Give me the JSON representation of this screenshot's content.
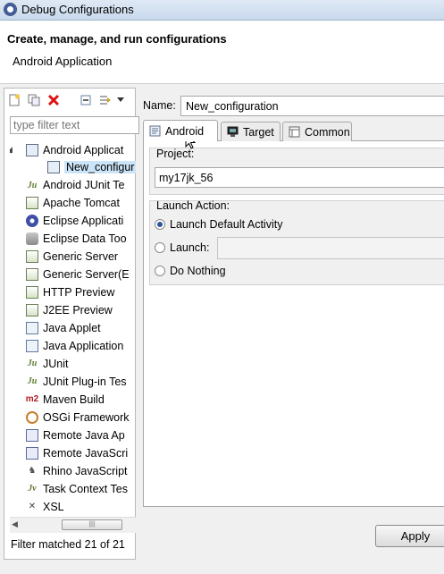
{
  "window": {
    "title": "Debug Configurations",
    "icon": "debug-gear-icon"
  },
  "header": {
    "title": "Create, manage, and run configurations",
    "subtitle": "Android Application"
  },
  "left_toolbar": {
    "buttons": [
      "new-config-icon",
      "duplicate-icon",
      "delete-icon",
      "collapse-all-icon",
      "filter-icon",
      "dropdown-icon"
    ]
  },
  "filter": {
    "placeholder": "type filter text",
    "value": ""
  },
  "tree": {
    "items": [
      {
        "label": "Android Applicat",
        "icon": "android-app-icon",
        "level": 1,
        "expanded": true
      },
      {
        "label": "New_configur",
        "icon": "android-config-icon",
        "level": 2,
        "selected": true
      },
      {
        "label": "Android JUnit Te",
        "icon": "junit-icon",
        "level": 1
      },
      {
        "label": "Apache Tomcat",
        "icon": "server-icon",
        "level": 1
      },
      {
        "label": "Eclipse Applicati",
        "icon": "eclipse-icon",
        "level": 1
      },
      {
        "label": "Eclipse Data Too",
        "icon": "database-icon",
        "level": 1
      },
      {
        "label": "Generic Server",
        "icon": "server-icon",
        "level": 1
      },
      {
        "label": "Generic Server(E",
        "icon": "server-icon",
        "level": 1
      },
      {
        "label": "HTTP Preview",
        "icon": "server-icon",
        "level": 1
      },
      {
        "label": "J2EE Preview",
        "icon": "server-icon",
        "level": 1
      },
      {
        "label": "Java Applet",
        "icon": "applet-icon",
        "level": 1
      },
      {
        "label": "Java Application",
        "icon": "java-app-icon",
        "level": 1
      },
      {
        "label": "JUnit",
        "icon": "junit-icon",
        "level": 1
      },
      {
        "label": "JUnit Plug-in Tes",
        "icon": "junit-plugin-icon",
        "level": 1
      },
      {
        "label": "Maven Build",
        "icon": "maven-icon",
        "level": 1
      },
      {
        "label": "OSGi Framework",
        "icon": "osgi-icon",
        "level": 1
      },
      {
        "label": "Remote Java Ap",
        "icon": "remote-java-icon",
        "level": 1
      },
      {
        "label": "Remote JavaScri",
        "icon": "remote-js-icon",
        "level": 1
      },
      {
        "label": "Rhino JavaScript",
        "icon": "rhino-icon",
        "level": 1
      },
      {
        "label": "Task Context Tes",
        "icon": "task-context-icon",
        "level": 1
      },
      {
        "label": "XSL",
        "icon": "xsl-icon",
        "level": 1
      }
    ]
  },
  "filter_status": "Filter matched 21 of 21",
  "name_field": {
    "label": "Name:",
    "value": "New_configuration"
  },
  "tabs": [
    {
      "label": "Android",
      "icon": "android-tab-icon",
      "active": true
    },
    {
      "label": "Target",
      "icon": "target-tab-icon",
      "active": false
    },
    {
      "label": "Common",
      "icon": "common-tab-icon",
      "active": false
    }
  ],
  "project": {
    "group_label": "Project:",
    "value": "my17jk_56"
  },
  "launch_action": {
    "group_label": "Launch Action:",
    "options": [
      {
        "label": "Launch Default Activity",
        "selected": true
      },
      {
        "label": "Launch:",
        "selected": false
      },
      {
        "label": "Do Nothing",
        "selected": false
      }
    ],
    "activity_value": ""
  },
  "buttons": {
    "apply": "Apply"
  },
  "colors": {
    "accent": "#2b5599",
    "selection": "#cce4f7"
  }
}
